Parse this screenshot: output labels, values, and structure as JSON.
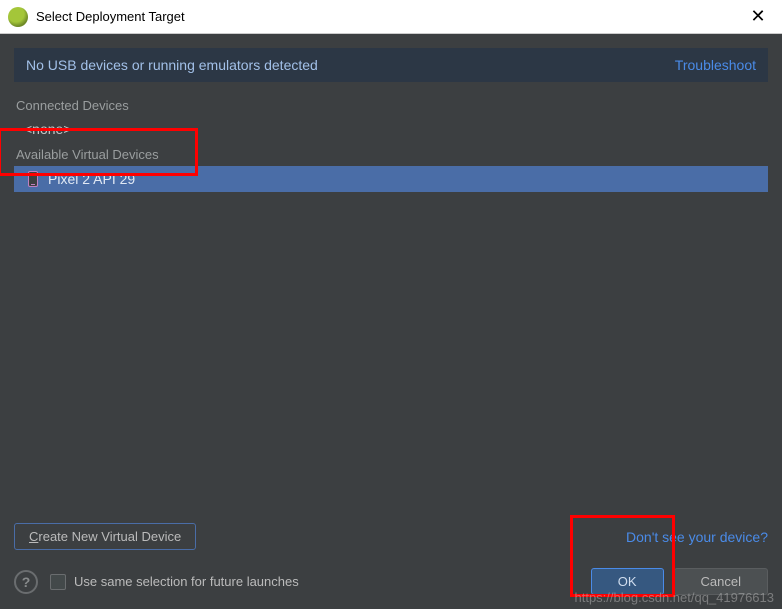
{
  "titlebar": {
    "title": "Select Deployment Target"
  },
  "message": {
    "text": "No USB devices or running emulators detected",
    "troubleshoot": "Troubleshoot"
  },
  "sections": {
    "connected_label": "Connected Devices",
    "connected_none": "<none>",
    "available_label": "Available Virtual Devices"
  },
  "devices": {
    "selected": "Pixel 2 API 29"
  },
  "buttons": {
    "create_prefix": "C",
    "create_rest": "reate New Virtual Device",
    "dont_see": "Don't see your device?",
    "ok": "OK",
    "cancel": "Cancel"
  },
  "checkbox": {
    "label": "Use same selection for future launches"
  },
  "watermark": "https://blog.csdn.net/qq_41976613"
}
